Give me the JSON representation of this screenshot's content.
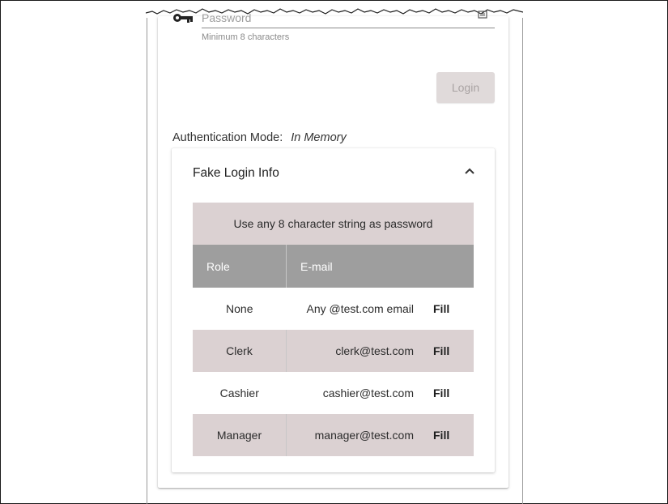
{
  "password": {
    "placeholder": "Password",
    "value": "",
    "hint": "Minimum 8 characters"
  },
  "actions": {
    "login_label": "Login"
  },
  "auth": {
    "label": "Authentication Mode:",
    "value": "In Memory"
  },
  "fake_login": {
    "title": "Fake Login Info",
    "note": "Use any 8 character string as password",
    "headers": [
      "Role",
      "E-mail"
    ],
    "rows": [
      {
        "role": "None",
        "email": "Any @test.com email",
        "action": "Fill"
      },
      {
        "role": "Clerk",
        "email": "clerk@test.com",
        "action": "Fill"
      },
      {
        "role": "Cashier",
        "email": "cashier@test.com",
        "action": "Fill"
      },
      {
        "role": "Manager",
        "email": "manager@test.com",
        "action": "Fill"
      }
    ]
  },
  "icons": {
    "password": "key-icon",
    "visibility": "password-visibility-icon",
    "collapse": "chevron-up-icon"
  },
  "colors": {
    "header_bg": "#9e9e9e",
    "shaded_row_bg": "#dbd1d2",
    "disabled_button_bg": "#e0dada"
  }
}
